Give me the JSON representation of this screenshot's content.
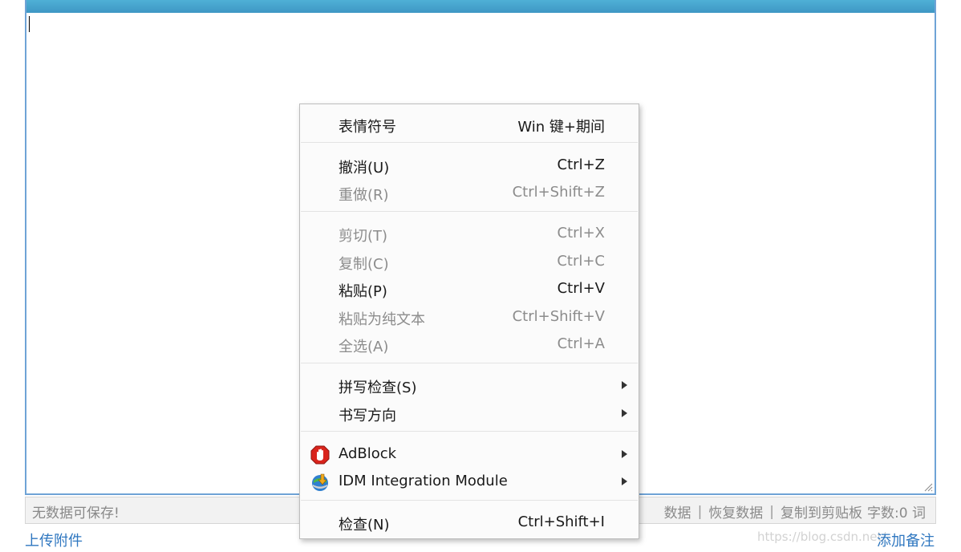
{
  "status_bar": {
    "left_text": "无数据可保存!",
    "actions": [
      "数据",
      "恢复数据",
      "复制到剪贴板"
    ],
    "count_label": "字数:",
    "count_value": "0",
    "count_unit": "词"
  },
  "footer": {
    "upload": "上传附件",
    "add_note": "添加备注",
    "watermark": "https://blog.csdn.net/"
  },
  "menu": {
    "groups": [
      {
        "items": [
          {
            "label": "表情符号",
            "shortcut": "Win 键+期间",
            "disabled": false
          }
        ]
      },
      {
        "items": [
          {
            "label": "撤消(U)",
            "shortcut": "Ctrl+Z",
            "disabled": false
          },
          {
            "label": "重做(R)",
            "shortcut": "Ctrl+Shift+Z",
            "disabled": true
          }
        ]
      },
      {
        "items": [
          {
            "label": "剪切(T)",
            "shortcut": "Ctrl+X",
            "disabled": true
          },
          {
            "label": "复制(C)",
            "shortcut": "Ctrl+C",
            "disabled": true
          },
          {
            "label": "粘贴(P)",
            "shortcut": "Ctrl+V",
            "disabled": false
          },
          {
            "label": "粘贴为纯文本",
            "shortcut": "Ctrl+Shift+V",
            "disabled": true
          },
          {
            "label": "全选(A)",
            "shortcut": "Ctrl+A",
            "disabled": true
          }
        ]
      },
      {
        "items": [
          {
            "label": "拼写检查(S)",
            "submenu": true
          },
          {
            "label": "书写方向",
            "submenu": true
          }
        ]
      },
      {
        "items": [
          {
            "label": "AdBlock",
            "submenu": true,
            "icon": "adblock-icon"
          },
          {
            "label": "IDM Integration Module",
            "submenu": true,
            "icon": "idm-icon"
          }
        ]
      },
      {
        "items": [
          {
            "label": "检查(N)",
            "shortcut": "Ctrl+Shift+I",
            "disabled": false
          }
        ]
      }
    ]
  },
  "colors": {
    "accent": "#3e97c4",
    "link": "#2f77c0",
    "disabled_text": "#8c8c8c"
  }
}
